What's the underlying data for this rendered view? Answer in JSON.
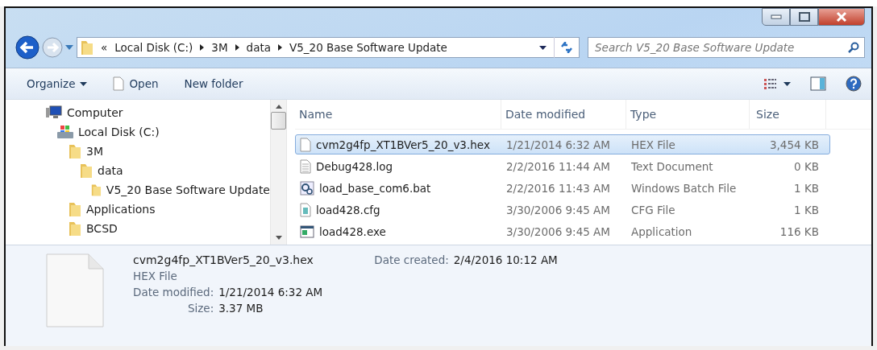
{
  "address": {
    "overflow": "«",
    "crumbs": [
      "Local Disk (C:)",
      "3M",
      "data",
      "V5_20 Base Software Update"
    ]
  },
  "search": {
    "placeholder": "Search V5_20 Base Software Update"
  },
  "toolbar": {
    "organize": "Organize",
    "open": "Open",
    "new_folder": "New folder"
  },
  "tree": [
    {
      "label": "Computer",
      "kind": "computer",
      "children": [
        {
          "label": "Local Disk (C:)",
          "kind": "disk",
          "children": [
            {
              "label": "3M",
              "kind": "folder",
              "children": [
                {
                  "label": "data",
                  "kind": "folder",
                  "children": [
                    {
                      "label": "V5_20 Base Software Update",
                      "kind": "folder"
                    }
                  ]
                }
              ]
            },
            {
              "label": "Applications",
              "kind": "folder"
            },
            {
              "label": "BCSD",
              "kind": "folder"
            }
          ]
        }
      ]
    }
  ],
  "columns": [
    "Name",
    "Date modified",
    "Type",
    "Size"
  ],
  "files": [
    {
      "name": "cvm2g4fp_XT1BVer5_20_v3.hex",
      "date": "1/21/2014 6:32 AM",
      "type": "HEX File",
      "size": "3,454 KB",
      "kind": "blank",
      "selected": true
    },
    {
      "name": "Debug428.log",
      "date": "2/2/2016 11:44 AM",
      "type": "Text Document",
      "size": "0 KB",
      "kind": "text",
      "selected": false
    },
    {
      "name": "load_base_com6.bat",
      "date": "2/2/2016 11:43 AM",
      "type": "Windows Batch File",
      "size": "1 KB",
      "kind": "batch",
      "selected": false
    },
    {
      "name": "load428.cfg",
      "date": "3/30/2006 9:45 AM",
      "type": "CFG File",
      "size": "1 KB",
      "kind": "config",
      "selected": false
    },
    {
      "name": "load428.exe",
      "date": "3/30/2006 9:45 AM",
      "type": "Application",
      "size": "116 KB",
      "kind": "exe",
      "selected": false
    }
  ],
  "details": {
    "name": "cvm2g4fp_XT1BVer5_20_v3.hex",
    "type": "HEX File",
    "fields": [
      {
        "label": "Date modified:",
        "value": "1/21/2014 6:32 AM"
      },
      {
        "label": "Size:",
        "value": "3.37 MB"
      }
    ],
    "created": {
      "label": "Date created:",
      "value": "2/4/2016 10:12 AM"
    }
  }
}
